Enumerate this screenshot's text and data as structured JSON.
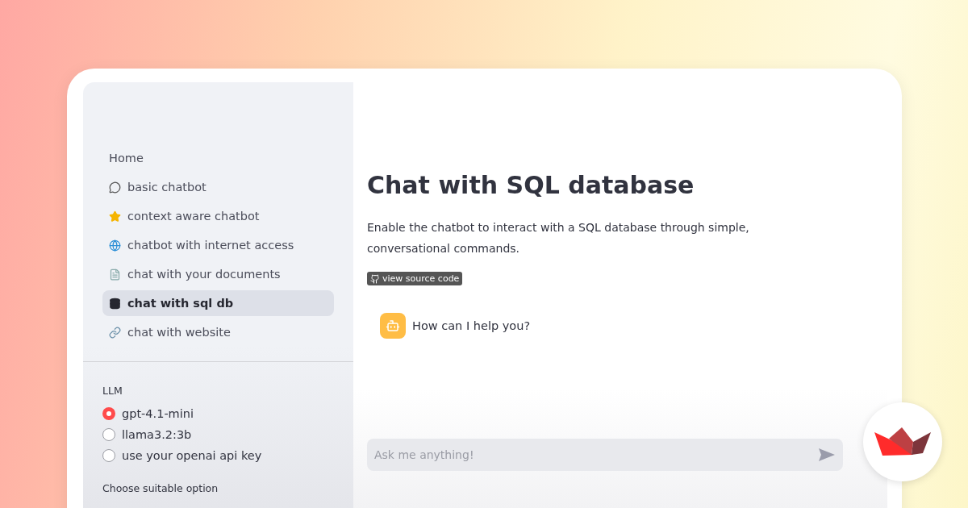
{
  "sidebar": {
    "nav": [
      {
        "label": "Home",
        "selected": false
      },
      {
        "label": "basic chatbot",
        "selected": false
      },
      {
        "label": "context aware chatbot",
        "selected": false
      },
      {
        "label": "chatbot with internet access",
        "selected": false
      },
      {
        "label": "chat with your documents",
        "selected": false
      },
      {
        "label": "chat with sql db",
        "selected": true
      },
      {
        "label": "chat with website",
        "selected": false
      }
    ],
    "llm": {
      "label": "LLM",
      "options": [
        {
          "label": "gpt-4.1-mini",
          "selected": true
        },
        {
          "label": "llama3.2:3b",
          "selected": false
        },
        {
          "label": "use your openai api key",
          "selected": false
        }
      ]
    },
    "option_label": "Choose suitable option"
  },
  "main": {
    "title": "Chat with SQL database",
    "description": "Enable the chatbot to interact with a SQL database through simple, conversational commands.",
    "source_badge": "view source code",
    "messages": [
      {
        "text": "How can I help you?"
      }
    ],
    "chat_input": {
      "placeholder": "Ask me anything!"
    }
  }
}
